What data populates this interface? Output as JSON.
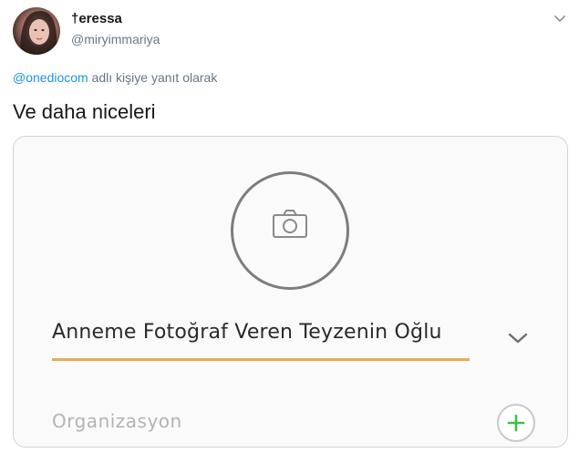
{
  "tweet": {
    "user": {
      "display_name": "†eressa",
      "handle": "@miryimmariya"
    },
    "reply_to": {
      "mention": "@onediocom",
      "suffix": " adlı kişiye yanıt olarak"
    },
    "text": "Ve daha niceleri"
  },
  "media": {
    "name_value": "Anneme Fotoğraf Veren Teyzenin Oğlu",
    "organization_placeholder": "Organizasyon",
    "icons": {
      "photo": "camera-icon",
      "dropdown": "chevron-down-icon",
      "add": "plus-icon",
      "menu": "chevron-down-icon"
    },
    "colors": {
      "underline": "#e2ad5b",
      "plus": "#3fbf4a",
      "mention": "#1b95e0"
    }
  }
}
